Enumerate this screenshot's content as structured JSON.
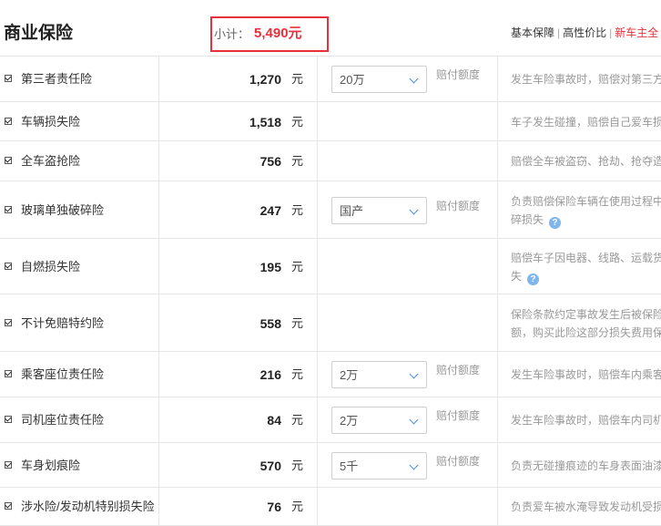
{
  "header": {
    "title": "商业保险",
    "subtotal_label": "小计：",
    "subtotal_value": "5,490元",
    "plans": [
      "基本保障",
      "高性价比",
      "新车主全"
    ],
    "plan_separator": "|"
  },
  "unit": "元",
  "amount_label": "赔付额度",
  "help_glyph": "?",
  "items": [
    {
      "name": "第三者责任险",
      "price": "1,270",
      "select": "20万",
      "desc": [
        "发生车险事故时，赔偿对第三方"
      ]
    },
    {
      "name": "车辆损失险",
      "price": "1,518",
      "select": "",
      "desc": [
        "车子发生碰撞，赔偿自己爱车损"
      ]
    },
    {
      "name": "全车盗抢险",
      "price": "756",
      "select": "",
      "desc": [
        "赔偿全车被盗窃、抢劫、抢夺造"
      ]
    },
    {
      "name": "玻璃单独破碎险",
      "price": "247",
      "select": "国产",
      "desc": [
        "负责赔偿保险车辆在使用过程中",
        "碎损失"
      ]
    },
    {
      "name": "自燃损失险",
      "price": "195",
      "select": "",
      "desc": [
        "赔偿车子因电器、线路、运载货",
        "失"
      ]
    },
    {
      "name": "不计免赔特约险",
      "price": "558",
      "select": "",
      "desc": [
        "保险条款约定事故发生后被保险",
        "额，购买此险这部分损失费用保"
      ]
    },
    {
      "name": "乘客座位责任险",
      "price": "216",
      "select": "2万",
      "desc": [
        "发生车险事故时，赔偿车内乘客"
      ]
    },
    {
      "name": "司机座位责任险",
      "price": "84",
      "select": "2万",
      "desc": [
        "发生车险事故时，赔偿车内司机"
      ]
    },
    {
      "name": "车身划痕险",
      "price": "570",
      "select": "5千",
      "desc": [
        "负责无碰撞痕迹的车身表面油漆"
      ]
    },
    {
      "name": "涉水险/发动机特别损失险",
      "price": "76",
      "select": "",
      "desc": [
        "负责爱车被水淹导致发动机受损"
      ]
    }
  ]
}
